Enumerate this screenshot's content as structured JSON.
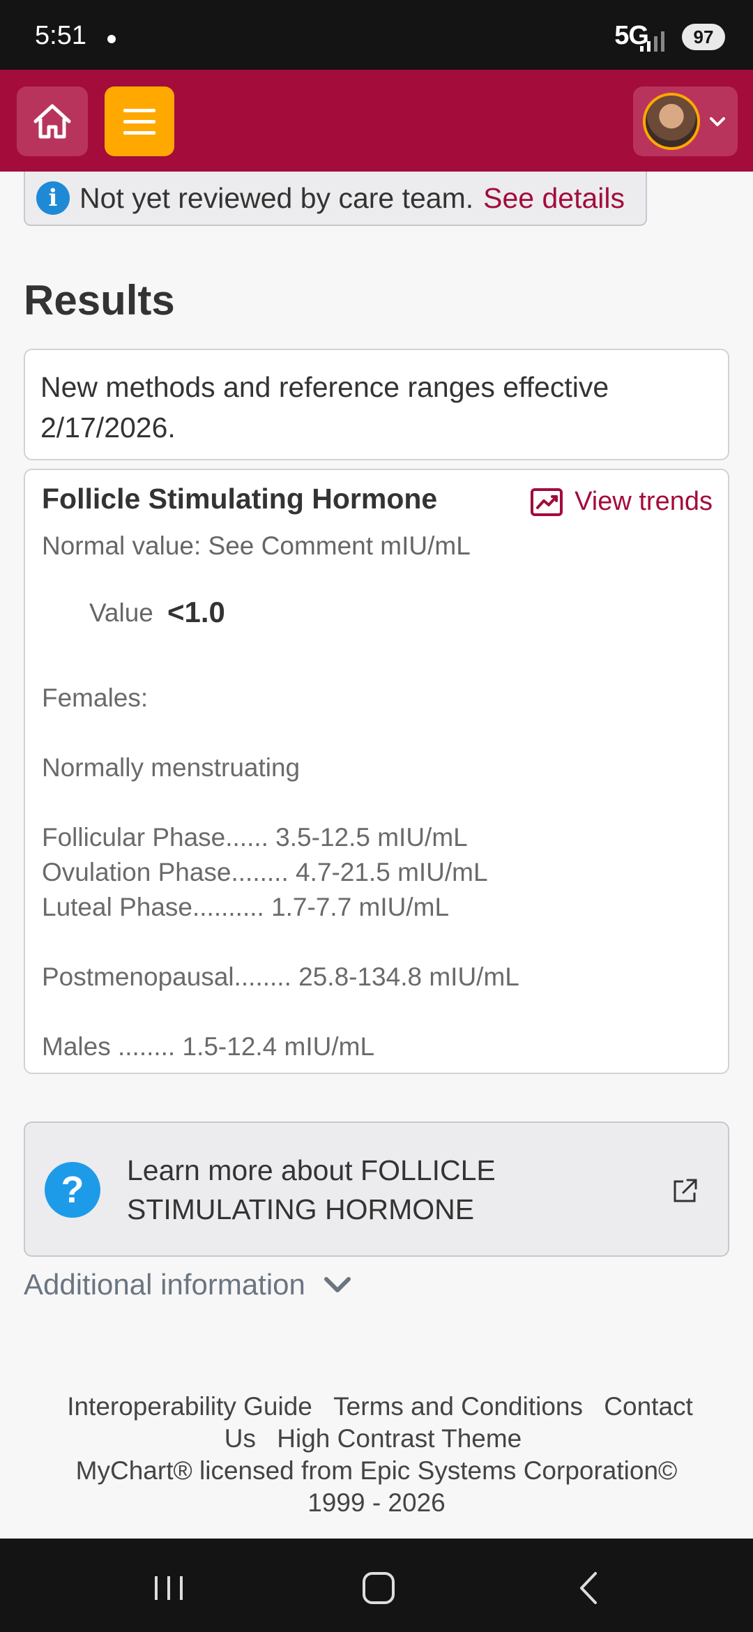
{
  "status_bar": {
    "time": "5:51",
    "network": "5G",
    "battery": "97"
  },
  "header": {
    "colors": {
      "brand": "#a30c3b",
      "menu": "#ffa800"
    }
  },
  "review_banner": {
    "text": "Not yet reviewed by care team.",
    "link": "See details"
  },
  "results": {
    "title": "Results",
    "method_note": "New methods and reference ranges effective 2/17/2026.",
    "test": {
      "name": "Follicle Stimulating Hormone",
      "view_trends": "View trends",
      "normal_value": "Normal value: See Comment mIU/mL",
      "value_label": "Value",
      "value": "<1.0",
      "comment_lines": [
        "Females:",
        "Normally menstruating",
        "Follicular Phase...... 3.5-12.5 mIU/mL",
        "Ovulation Phase........ 4.7-21.5 mIU/mL",
        "Luteal Phase.......... 1.7-7.7 mIU/mL",
        "Postmenopausal........ 25.8-134.8 mIU/mL",
        "Males ........ 1.5-12.4 mIU/mL"
      ]
    }
  },
  "learn_more": {
    "line1": "Learn more about FOLLICLE",
    "line2": "STIMULATING HORMONE"
  },
  "additional_info": "Additional information",
  "footer": {
    "interop": "Interoperability Guide",
    "terms": "Terms and Conditions",
    "contact": "Contact Us",
    "high_contrast": "High Contrast Theme",
    "license": "MyChart® licensed from Epic Systems Corporation©",
    "years": "1999 - 2026"
  }
}
